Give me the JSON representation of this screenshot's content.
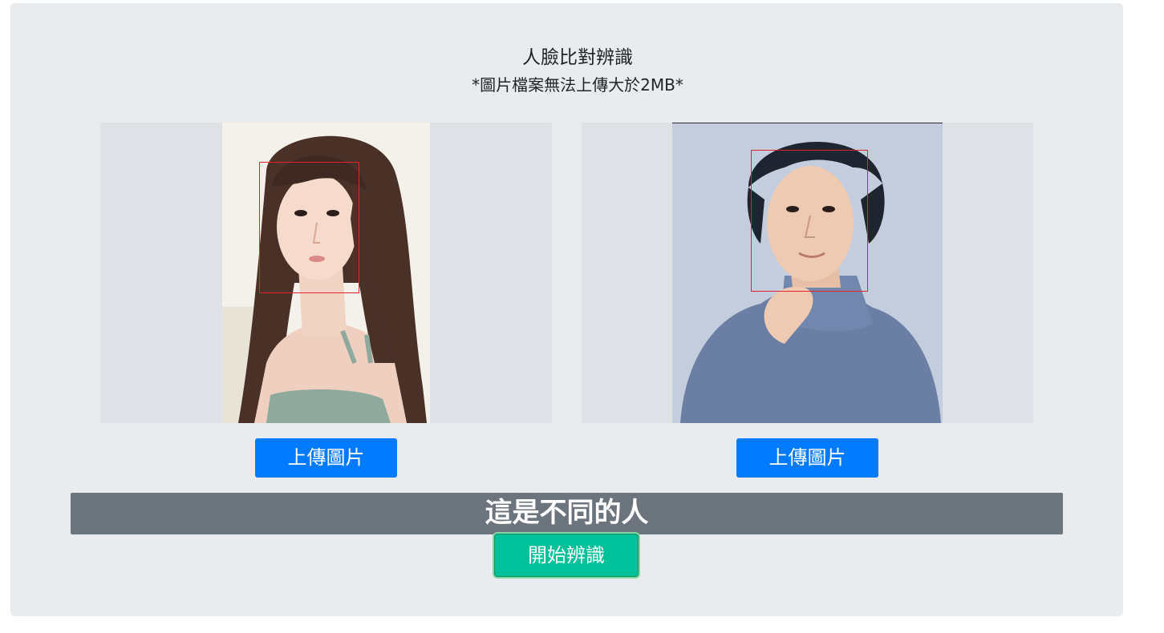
{
  "header": {
    "title": "人臉比對辨識",
    "subtitle": "*圖片檔案無法上傳大於2MB*"
  },
  "images": [
    {
      "name": "left-photo",
      "upload_label": "上傳圖片"
    },
    {
      "name": "right-photo",
      "upload_label": "上傳圖片"
    }
  ],
  "result": {
    "text": "這是不同的人"
  },
  "actions": {
    "start_label": "開始辨識"
  },
  "colors": {
    "panel_bg": "#e9ecef",
    "upload_button": "#007bff",
    "result_bar": "#6c757d",
    "start_button": "#00c19a",
    "face_box": "#e0242f"
  }
}
